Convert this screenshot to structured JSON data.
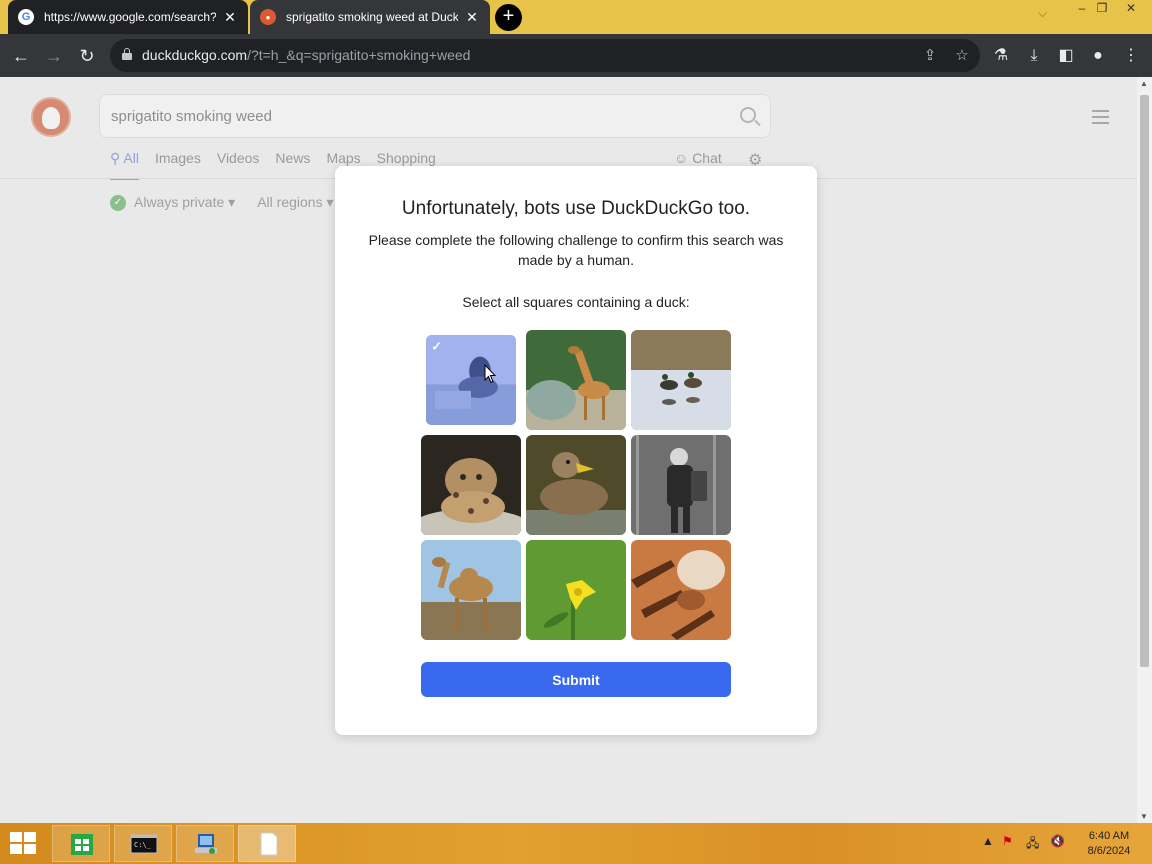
{
  "browser": {
    "tabs": [
      {
        "title": "https://www.google.com/search?q=",
        "favicon": "google-favicon"
      },
      {
        "title": "sprigatito smoking weed at DuckDu",
        "favicon": "duckduckgo-favicon"
      }
    ],
    "url_host": "duckduckgo.com",
    "url_path": "/?t=h_&q=sprigatito+smoking+weed"
  },
  "search": {
    "query": "sprigatito smoking weed",
    "tabs": [
      "All",
      "Images",
      "Videos",
      "News",
      "Maps",
      "Shopping"
    ],
    "chat_label": "Chat",
    "filters": [
      "Always private",
      "All regions"
    ]
  },
  "modal": {
    "title": "Unfortunately, bots use DuckDuckGo too.",
    "subtitle": "Please complete the following challenge to confirm this search was made by a human.",
    "prompt": "Select all squares containing a duck:",
    "submit_label": "Submit",
    "tiles": [
      {
        "subject": "duck",
        "selected": true
      },
      {
        "subject": "giraffe",
        "selected": false
      },
      {
        "subject": "ducks on water",
        "selected": false
      },
      {
        "subject": "leopard cat",
        "selected": false
      },
      {
        "subject": "duck",
        "selected": false
      },
      {
        "subject": "person",
        "selected": false
      },
      {
        "subject": "camel",
        "selected": false
      },
      {
        "subject": "yellow flower",
        "selected": false
      },
      {
        "subject": "tiger",
        "selected": false
      }
    ]
  },
  "taskbar": {
    "time": "6:40 AM",
    "date": "8/6/2024"
  },
  "colors": {
    "submit": "#3969ef",
    "taskbar": "#e2a031",
    "tab_active": "#202124"
  }
}
